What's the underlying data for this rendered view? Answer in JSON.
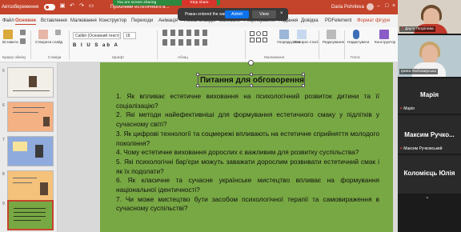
{
  "titlebar": {
    "autosave_label": "Автозбереження",
    "autosave_state": "off",
    "document_title": "Проблеми естетичного в...",
    "user_name": "Daria Pohrileva",
    "share_banner": "You are screen sharing",
    "stop_share": "Stop share"
  },
  "ribbon_tabs": [
    {
      "label": "Файл"
    },
    {
      "label": "Основне",
      "active": true
    },
    {
      "label": "Вставлення"
    },
    {
      "label": "Малювання"
    },
    {
      "label": "Конструктор"
    },
    {
      "label": "Переходи"
    },
    {
      "label": "Анімація"
    },
    {
      "label": "Показ слайдів"
    },
    {
      "label": "Записати"
    },
    {
      "label": "Рецензування"
    },
    {
      "label": "Подання"
    },
    {
      "label": "Довідка"
    },
    {
      "label": "PDFelement"
    },
    {
      "label": "Формат фігури"
    }
  ],
  "ribbon": {
    "clipboard_label": "Буфер обміну",
    "insert_label": "Вставити",
    "new_slide_label": "Створити слайд",
    "slides_label": "Слайди",
    "font_group_label": "Шрифт",
    "paragraph_group_label": "Абзац",
    "drawing_group_label": "Малювання",
    "editing_label": "Редагування",
    "dictate_label": "Надиктувати",
    "voice_label": "Голос",
    "designer_label": "Конструктор",
    "font_name": "Calibri (Основний текст)",
    "font_size": "18",
    "arrange_label": "Упорядкувати",
    "quick_styles_label": "Експрес-стилі"
  },
  "slides_panel": [
    {
      "number": "5"
    },
    {
      "number": "6"
    },
    {
      "number": "7"
    },
    {
      "number": "8"
    },
    {
      "number": "9",
      "selected": true
    }
  ],
  "slide": {
    "title": "Питання для обговорення",
    "questions": [
      "1. Як впливає естетичне виховання на психологічний розвиток дитини та її соціалізацію?",
      "2. Які методи найефективніші для формування естетичного смаку у підлітків у сучасному світі?",
      "3. Як цифрові технології та соцмережі впливають на естетичне сприйняття молодого покоління?",
      "4. Чому естетичне виховання дорослих є важливим для розвитку суспільства?",
      "5. Які психологічні бар'єри можуть заважати дорослим розвивати естетичний смак і як їх подолати?",
      "6. Як класичне та сучасне українське мистецтво впливає на формування національної ідентичності?",
      "7. Чи може мистецтво бути засобом психологічної терапії та самовираження в сучасному суспільстві?"
    ],
    "background_color": "#78a843"
  },
  "participants": [
    {
      "name": "Дар'я Погрілева",
      "muted": true,
      "has_video": true
    },
    {
      "name": "Ірина Любомирська",
      "muted": false,
      "has_video": true
    },
    {
      "display_name": "Марія",
      "name": "Марія",
      "muted": true,
      "has_video": false
    },
    {
      "display_name": "Максим Ручко...",
      "name": "Максим Ручковський",
      "muted": true,
      "has_video": false
    },
    {
      "display_name": "Коломієць Юлія",
      "name": "",
      "muted": false,
      "has_video": false
    }
  ],
  "waiting_room_popup": {
    "message": "Роман entered the waiting room",
    "admit_label": "Admit",
    "view_label": "View"
  },
  "colors": {
    "accent": "#c4432b",
    "slide_green": "#78a843",
    "admit_blue": "#0e72ed"
  }
}
